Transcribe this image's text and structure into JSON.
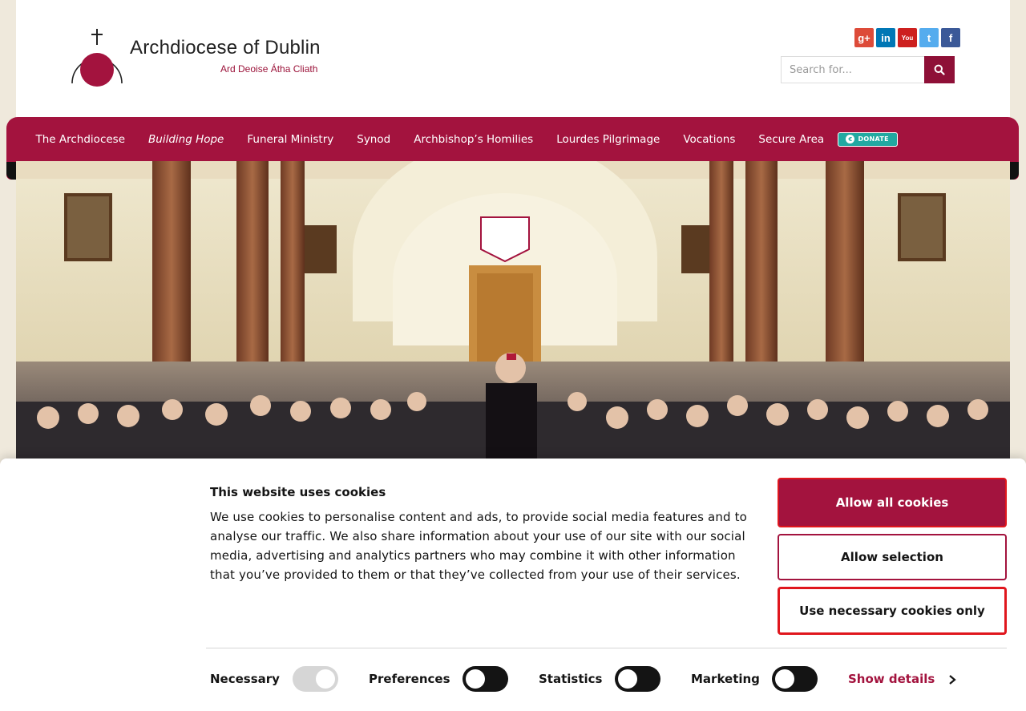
{
  "header": {
    "logo_title": "Archdiocese of Dublin",
    "logo_subtitle": "Ard Deoise Átha Cliath",
    "social": [
      {
        "name": "google-plus-icon",
        "glyph": "g+",
        "color": "#dd4b39"
      },
      {
        "name": "linkedin-icon",
        "glyph": "in",
        "color": "#0077b5"
      },
      {
        "name": "youtube-icon",
        "glyph": "You",
        "color": "#cd201f"
      },
      {
        "name": "twitter-icon",
        "glyph": "t",
        "color": "#55acee"
      },
      {
        "name": "facebook-icon",
        "glyph": "f",
        "color": "#3b5998"
      }
    ],
    "search_placeholder": "Search for..."
  },
  "nav": {
    "items": [
      {
        "label": "The Archdiocese",
        "italic": false
      },
      {
        "label": "Building Hope",
        "italic": true
      },
      {
        "label": "Funeral Ministry",
        "italic": false
      },
      {
        "label": "Synod",
        "italic": false
      },
      {
        "label": "Archbishop’s Homilies",
        "italic": false
      },
      {
        "label": "Lourdes Pilgrimage",
        "italic": false
      },
      {
        "label": "Vocations",
        "italic": false
      },
      {
        "label": "Secure Area",
        "italic": false
      }
    ],
    "donate_label": "DONATE"
  },
  "cookie": {
    "title": "This website uses cookies",
    "text": "We use cookies to personalise content and ads, to provide social media features and to analyse our traffic. We also share information about your use of our site with our social media, advertising and analytics partners who may combine it with other information that you’ve provided to them or that they’ve collected from your use of their services.",
    "allow_all": "Allow all cookies",
    "allow_selection": "Allow selection",
    "necessary_only": "Use necessary cookies only",
    "toggles": [
      {
        "label": "Necessary",
        "state": "on-disabled"
      },
      {
        "label": "Preferences",
        "state": "off"
      },
      {
        "label": "Statistics",
        "state": "off"
      },
      {
        "label": "Marketing",
        "state": "off"
      }
    ],
    "show_details": "Show details"
  },
  "colors": {
    "brand": "#a3133e",
    "accent_border": "#e0161d"
  }
}
